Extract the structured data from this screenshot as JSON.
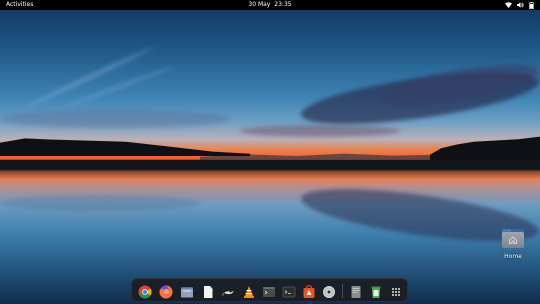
{
  "topbar": {
    "activities_label": "Activities",
    "date": "30 May",
    "time": "23:35",
    "tray_icons": [
      "network-wifi-icon",
      "volume-icon",
      "battery-icon"
    ]
  },
  "desktop": {
    "icons": [
      {
        "label": "Home",
        "icon": "folder-home-icon"
      }
    ]
  },
  "dock": {
    "apps": [
      {
        "name": "Google Chrome",
        "icon": "chrome-icon"
      },
      {
        "name": "Firefox",
        "icon": "firefox-icon"
      },
      {
        "name": "Files",
        "icon": "files-icon"
      },
      {
        "name": "Text Editor",
        "icon": "text-editor-icon"
      },
      {
        "name": "Mouse app",
        "icon": "mouse-icon"
      },
      {
        "name": "VLC",
        "icon": "vlc-icon"
      },
      {
        "name": "Terminal",
        "icon": "terminal-icon"
      },
      {
        "name": "Terminal 2",
        "icon": "terminal-dark-icon"
      },
      {
        "name": "Ubuntu Software",
        "icon": "software-store-icon"
      },
      {
        "name": "Disc",
        "icon": "disc-icon"
      },
      {
        "name": "Notes",
        "icon": "notes-icon"
      },
      {
        "name": "Trash",
        "icon": "trash-icon"
      }
    ],
    "show_apps_icon": "show-applications-icon"
  },
  "colors": {
    "topbar": "#000000",
    "dock_bg": "#1c1c20",
    "sky_top": "#143a66",
    "sunset": "#ff5a2a"
  }
}
